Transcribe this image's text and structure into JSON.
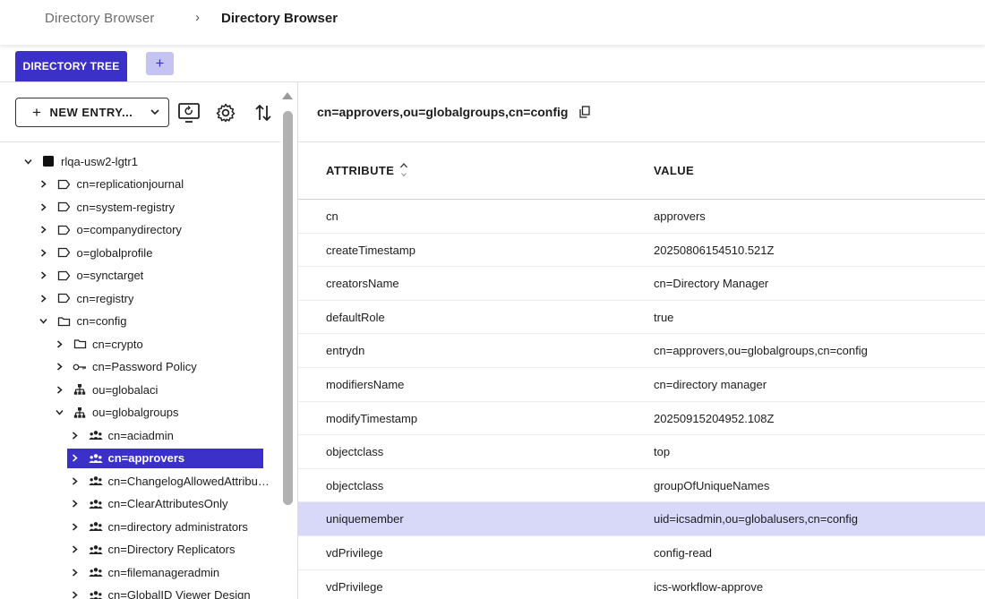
{
  "breadcrumb": {
    "root": "Directory Browser",
    "separator": "›",
    "current": "Directory Browser"
  },
  "tabs": {
    "active_label": "DIRECTORY TREE",
    "add_label": "+"
  },
  "toolbar": {
    "new_entry_plus": "+",
    "new_entry_label": "NEW ENTRY...",
    "icons": [
      "monitor-refresh-icon",
      "gear-icon",
      "sort-arrows-icon"
    ]
  },
  "tree": [
    {
      "level": 0,
      "expanded": true,
      "icon": "server-square-icon",
      "label": "rlqa-usw2-lgtr1"
    },
    {
      "level": 1,
      "expanded": false,
      "icon": "tag-icon",
      "label": "cn=replicationjournal"
    },
    {
      "level": 1,
      "expanded": false,
      "icon": "tag-icon",
      "label": "cn=system-registry"
    },
    {
      "level": 1,
      "expanded": false,
      "icon": "tag-icon",
      "label": "o=companydirectory"
    },
    {
      "level": 1,
      "expanded": false,
      "icon": "tag-icon",
      "label": "o=globalprofile"
    },
    {
      "level": 1,
      "expanded": false,
      "icon": "tag-icon",
      "label": "o=synctarget"
    },
    {
      "level": 1,
      "expanded": false,
      "icon": "tag-icon",
      "label": "cn=registry"
    },
    {
      "level": 1,
      "expanded": true,
      "icon": "folder-icon",
      "label": "cn=config"
    },
    {
      "level": 2,
      "expanded": false,
      "icon": "folder-icon",
      "label": "cn=crypto"
    },
    {
      "level": 2,
      "expanded": false,
      "icon": "key-icon",
      "label": "cn=Password Policy"
    },
    {
      "level": 2,
      "expanded": false,
      "icon": "org-chart-icon",
      "label": "ou=globalaci"
    },
    {
      "level": 2,
      "expanded": true,
      "icon": "org-chart-icon",
      "label": "ou=globalgroups"
    },
    {
      "level": 3,
      "expanded": false,
      "icon": "group-icon",
      "label": "cn=aciadmin"
    },
    {
      "level": 3,
      "expanded": false,
      "icon": "group-icon",
      "label": "cn=approvers",
      "selected": true
    },
    {
      "level": 3,
      "expanded": false,
      "icon": "group-icon",
      "label": "cn=ChangelogAllowedAttribut..."
    },
    {
      "level": 3,
      "expanded": false,
      "icon": "group-icon",
      "label": "cn=ClearAttributesOnly"
    },
    {
      "level": 3,
      "expanded": false,
      "icon": "group-icon",
      "label": "cn=directory administrators"
    },
    {
      "level": 3,
      "expanded": false,
      "icon": "group-icon",
      "label": "cn=Directory Replicators"
    },
    {
      "level": 3,
      "expanded": false,
      "icon": "group-icon",
      "label": "cn=filemanageradmin"
    },
    {
      "level": 3,
      "expanded": false,
      "icon": "group-icon",
      "label": "cn=GlobalID Viewer Design"
    }
  ],
  "detail": {
    "dn": "cn=approvers,ou=globalgroups,cn=config",
    "columns": {
      "attribute": "ATTRIBUTE",
      "value": "VALUE"
    },
    "rows": [
      {
        "attribute": "cn",
        "value": "approvers"
      },
      {
        "attribute": "createTimestamp",
        "value": "20250806154510.521Z"
      },
      {
        "attribute": "creatorsName",
        "value": "cn=Directory Manager"
      },
      {
        "attribute": "defaultRole",
        "value": "true"
      },
      {
        "attribute": "entrydn",
        "value": "cn=approvers,ou=globalgroups,cn=config"
      },
      {
        "attribute": "modifiersName",
        "value": "cn=directory manager"
      },
      {
        "attribute": "modifyTimestamp",
        "value": "20250915204952.108Z"
      },
      {
        "attribute": "objectclass",
        "value": "top"
      },
      {
        "attribute": "objectclass",
        "value": "groupOfUniqueNames"
      },
      {
        "attribute": "uniquemember",
        "value": "uid=icsadmin,ou=globalusers,cn=config",
        "highlighted": true
      },
      {
        "attribute": "vdPrivilege",
        "value": "config-read"
      },
      {
        "attribute": "vdPrivilege",
        "value": "ics-workflow-approve"
      }
    ]
  },
  "colors": {
    "accent": "#3b30c8",
    "accent_light": "#c5c3f1",
    "row_highlight": "#d8d8f8",
    "scrollbar": "#b1b1b1"
  }
}
